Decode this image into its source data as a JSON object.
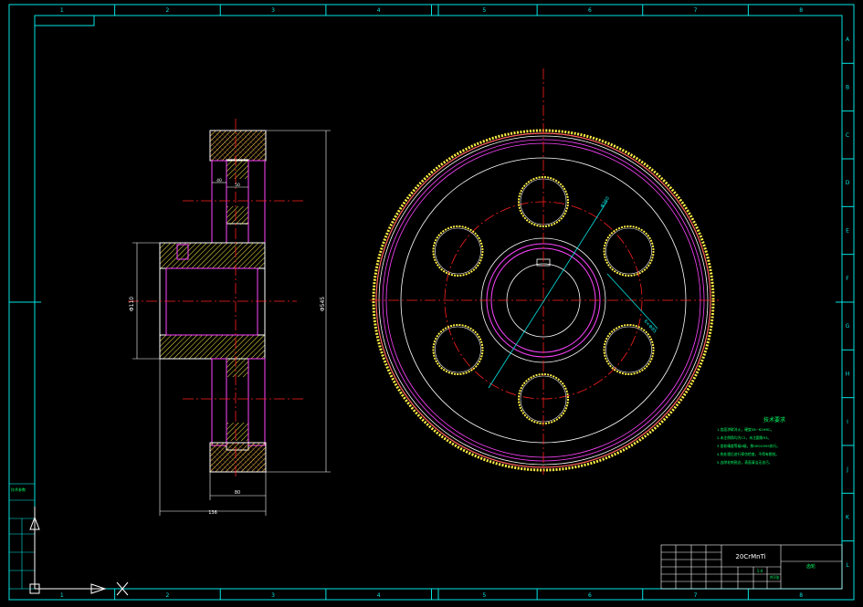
{
  "frame": {
    "col_labels": [
      "1",
      "2",
      "3",
      "4",
      "5",
      "6",
      "7",
      "8"
    ],
    "row_labels": [
      "A",
      "B",
      "C",
      "D",
      "E",
      "F",
      "G",
      "H",
      "I",
      "J",
      "K",
      "L"
    ]
  },
  "drawing": {
    "material": "20CrMnTi",
    "section_dims": {
      "bore_dia": "Φ110",
      "outer_dia": "Φ545",
      "hub_width": "136",
      "rim_width": "80",
      "web_a": "40",
      "web_b": "50"
    },
    "front_dims": {
      "pcd": "Φ360",
      "hole": "6×Φ85"
    },
    "notes_title": "技术要求",
    "notes": [
      "1.齿面渗碳淬火，硬度58~62HRC。",
      "2.未注倒角均为C2，未注圆角R3。",
      "3.齿轮精度等级8级，按GB10095执行。",
      "4.热处理后进行探伤检查，不得有裂纹。",
      "5.去除毛刺锐边，表面清洁无油污。"
    ],
    "title_block": {
      "part_name": "齿轮",
      "scale": "1:4",
      "sheet": "共1张"
    },
    "left_table": [
      "技术参数",
      "",
      ""
    ]
  },
  "colors": {
    "frame": "#00e5e5",
    "outline": "#ffffff",
    "center": "#ff2020",
    "hatch": "#ffee44",
    "magenta": "#ff44ff",
    "text": "#00ff66"
  }
}
